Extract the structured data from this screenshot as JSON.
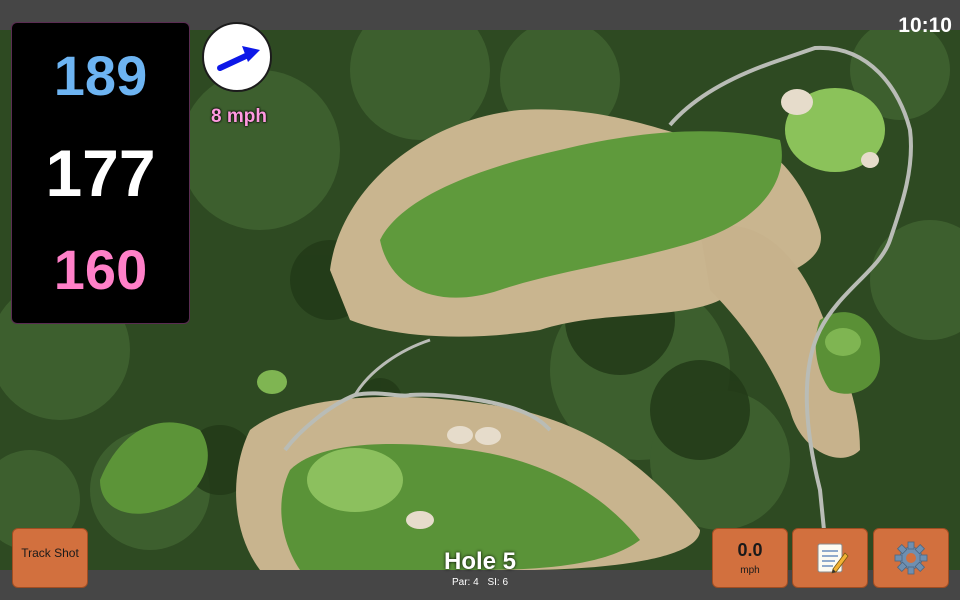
{
  "status": {
    "clock": "10:10"
  },
  "yardage": {
    "back": "189",
    "middle": "177",
    "front": "160"
  },
  "wind": {
    "speed": "8 mph",
    "direction_icon": "wind-arrow-icon"
  },
  "buttons": {
    "track_shot": "Track Shot",
    "speed_value": "0.0",
    "speed_unit": "mph",
    "notes_icon": "notepad-icon",
    "settings_icon": "gear-icon"
  },
  "hole": {
    "title": "Hole 5",
    "par": "Par: 4",
    "stroke_index": "SI: 6"
  },
  "colors": {
    "back_yardage": "#6db4f2",
    "middle_yardage": "#ffffff",
    "front_yardage": "#ff80c8",
    "wind_text": "#ff9ae0",
    "button": "#d2703e",
    "bar": "#464646"
  }
}
